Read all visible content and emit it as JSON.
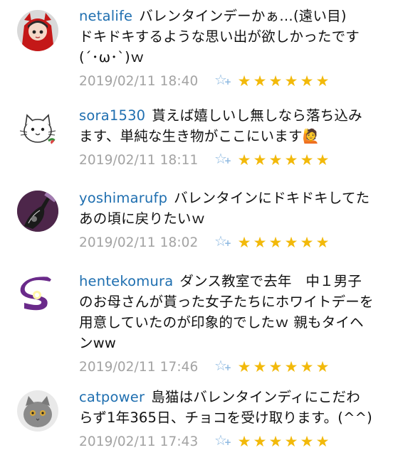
{
  "comments": [
    {
      "user": "netalife",
      "text": "バレンタインデーかぁ…(遠い目)　ドキドキするような思い出が欲しかったです(´･ω･`)ｗ",
      "date": "2019/02/11 18:40",
      "avatar": "red-hood-anime-girl-avatar",
      "stars": 6
    },
    {
      "user": "sora1530",
      "text": "貰えば嬉しいし無しなら落ち込みます、単純な生き物がここにいます🙋",
      "date": "2019/02/11 18:11",
      "avatar": "white-cat-doodle-avatar",
      "stars": 6
    },
    {
      "user": "yoshimarufp",
      "text": "バレンタインにドキドキしてたあの頃に戻りたいｗ",
      "date": "2019/02/11 18:02",
      "avatar": "guitar-photo-avatar",
      "stars": 6
    },
    {
      "user": "hentekomura",
      "text": "ダンス教室で去年　中１男子のお母さんが貰った女子たちにホワイトデーを用意していたのが印象的でしたｗ 親もタイヘンww",
      "date": "2019/02/11 17:46",
      "avatar": "purple-s-logo-avatar",
      "stars": 6
    },
    {
      "user": "catpower",
      "text": "島猫はバレンタインディにこだわらず1年365日、チョコを受け取ります。(^^)",
      "date": "2019/02/11 17:43",
      "avatar": "gray-cat-photo-avatar",
      "stars": 6
    }
  ],
  "colors": {
    "username": "#1f6fb0",
    "date": "#a3a3a3",
    "star": "#f2b90a",
    "fav": "#8cb8e0"
  },
  "icons": {
    "fav": "favorite-star-plus-icon",
    "rating": "rating-star-icon"
  }
}
